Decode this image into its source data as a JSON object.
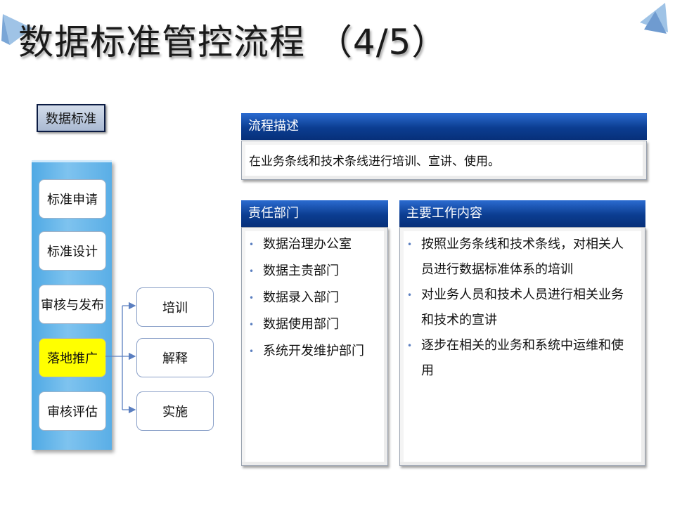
{
  "slide": {
    "title": "数据标准管控流程 （4/5）",
    "label": "数据标准",
    "steps": [
      "标准申请",
      "标准设计",
      "审核与发布",
      "落地推广",
      "审核评估"
    ],
    "sub_items": [
      "培训",
      "解释",
      "实施"
    ],
    "process_panel": {
      "header": "流程描述",
      "text": "在业务条线和技术条线进行培训、宣讲、使用。"
    },
    "dept_panel": {
      "header": "责任部门",
      "items": [
        "数据治理办公室",
        "数据主责部门",
        "数据录入部门",
        "数据使用部门",
        "系统开发维护部门"
      ]
    },
    "work_panel": {
      "header": "主要工作内容",
      "items": [
        [
          "按照业务条线和技术条线，对相关人",
          "员进行数据标准体系的培训"
        ],
        [
          "对业务人员和技术人员进行相关业务",
          "和技术的宣讲"
        ],
        [
          "逐步在相关的业务和系统中运维和使",
          "用"
        ]
      ]
    },
    "colors": {
      "active_step": "#ffff00",
      "header_blue": "#0b3d91",
      "column_blue": "#5aaee6"
    }
  }
}
